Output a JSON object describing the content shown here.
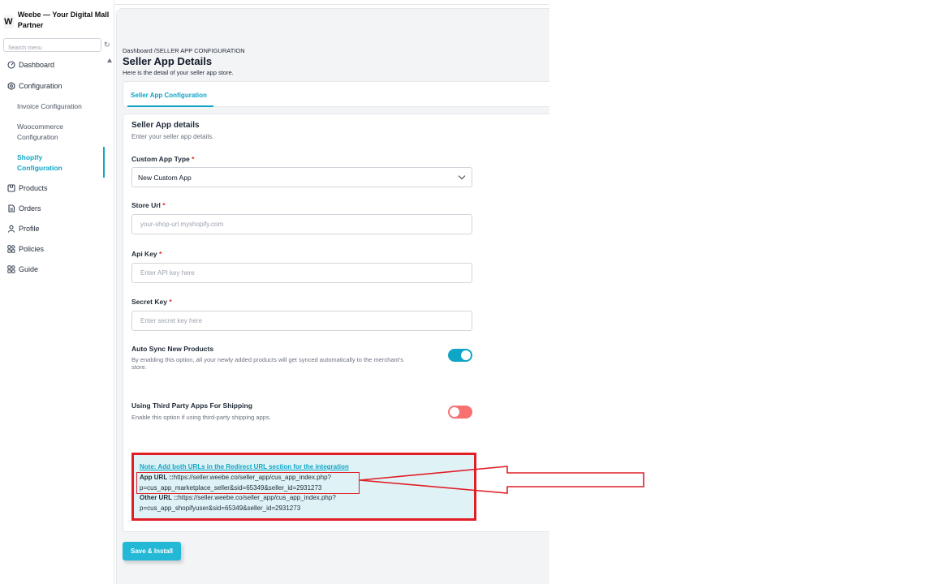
{
  "sidebar": {
    "brand_logo": "W",
    "brand_name": "Weebe — Your Digital Mall Partner",
    "search_placeholder": "Search menu",
    "items": [
      {
        "label": "Dashboard",
        "icon": "dashboard-icon"
      },
      {
        "label": "Configuration",
        "icon": "settings-icon"
      },
      {
        "label": "Products",
        "icon": "box-icon"
      },
      {
        "label": "Orders",
        "icon": "document-icon"
      },
      {
        "label": "Profile",
        "icon": "user-icon"
      },
      {
        "label": "Policies",
        "icon": "grid-icon"
      },
      {
        "label": "Guide",
        "icon": "grid-icon"
      }
    ],
    "sub_items": [
      {
        "label": "Invoice Configuration"
      },
      {
        "label": "Woocommerce Configuration"
      },
      {
        "label": "Shopify Configuration",
        "active": true
      }
    ]
  },
  "header": {
    "breadcrumb": "Dashboard /SELLER APP CONFIGURATION",
    "title": "Seller App Details",
    "subtitle": "Here is the detail of your seller app store."
  },
  "tabs": [
    {
      "label": "Seller App Configuration",
      "active": true
    }
  ],
  "form": {
    "title": "Seller App details",
    "subtitle": "Enter your seller app details.",
    "custom_app_type": {
      "label": "Custom App Type",
      "required": "*",
      "value": "New Custom App"
    },
    "store_url": {
      "label": "Store Url",
      "required": "*",
      "placeholder": "your-shop-url.myshopify.com"
    },
    "api_key": {
      "label": "Api Key",
      "required": "*",
      "placeholder": "Enter API key here"
    },
    "secret_key": {
      "label": "Secret Key",
      "required": "*",
      "placeholder": "Enter secret key here"
    },
    "auto_sync": {
      "title": "Auto Sync New Products",
      "description": "By enabling this option, all your newly added products will get synced automatically to the merchant's store.",
      "enabled": true
    },
    "third_party_shipping": {
      "title": "Using Third Party Apps For Shipping",
      "description": "Enable this option if using third-party shipping apps.",
      "enabled": false
    }
  },
  "note": {
    "title": "Note: Add both URLs in the Redirect URL section for the integration",
    "app_url_label": "App URL ::",
    "app_url_line1": "https://seller.weebe.co/seller_app/cus_app_index.php?",
    "app_url_line2": "p=cus_app_marketplace_seller&sid=65349&seller_id=2931273",
    "other_url_label": "Other URL ::",
    "other_url_line1": "https://seller.weebe.co/seller_app/cus_app_index.php?",
    "other_url_line2": "p=cus_app_shopifyuser&sid=65349&seller_id=2931273"
  },
  "actions": {
    "save_label": "Save & Install"
  },
  "colors": {
    "accent": "#0ea5c6",
    "toggle_on": "#0ea5c6",
    "toggle_off": "#f87171",
    "annotation_red": "#e11d26",
    "note_bg": "#dff3f6"
  }
}
